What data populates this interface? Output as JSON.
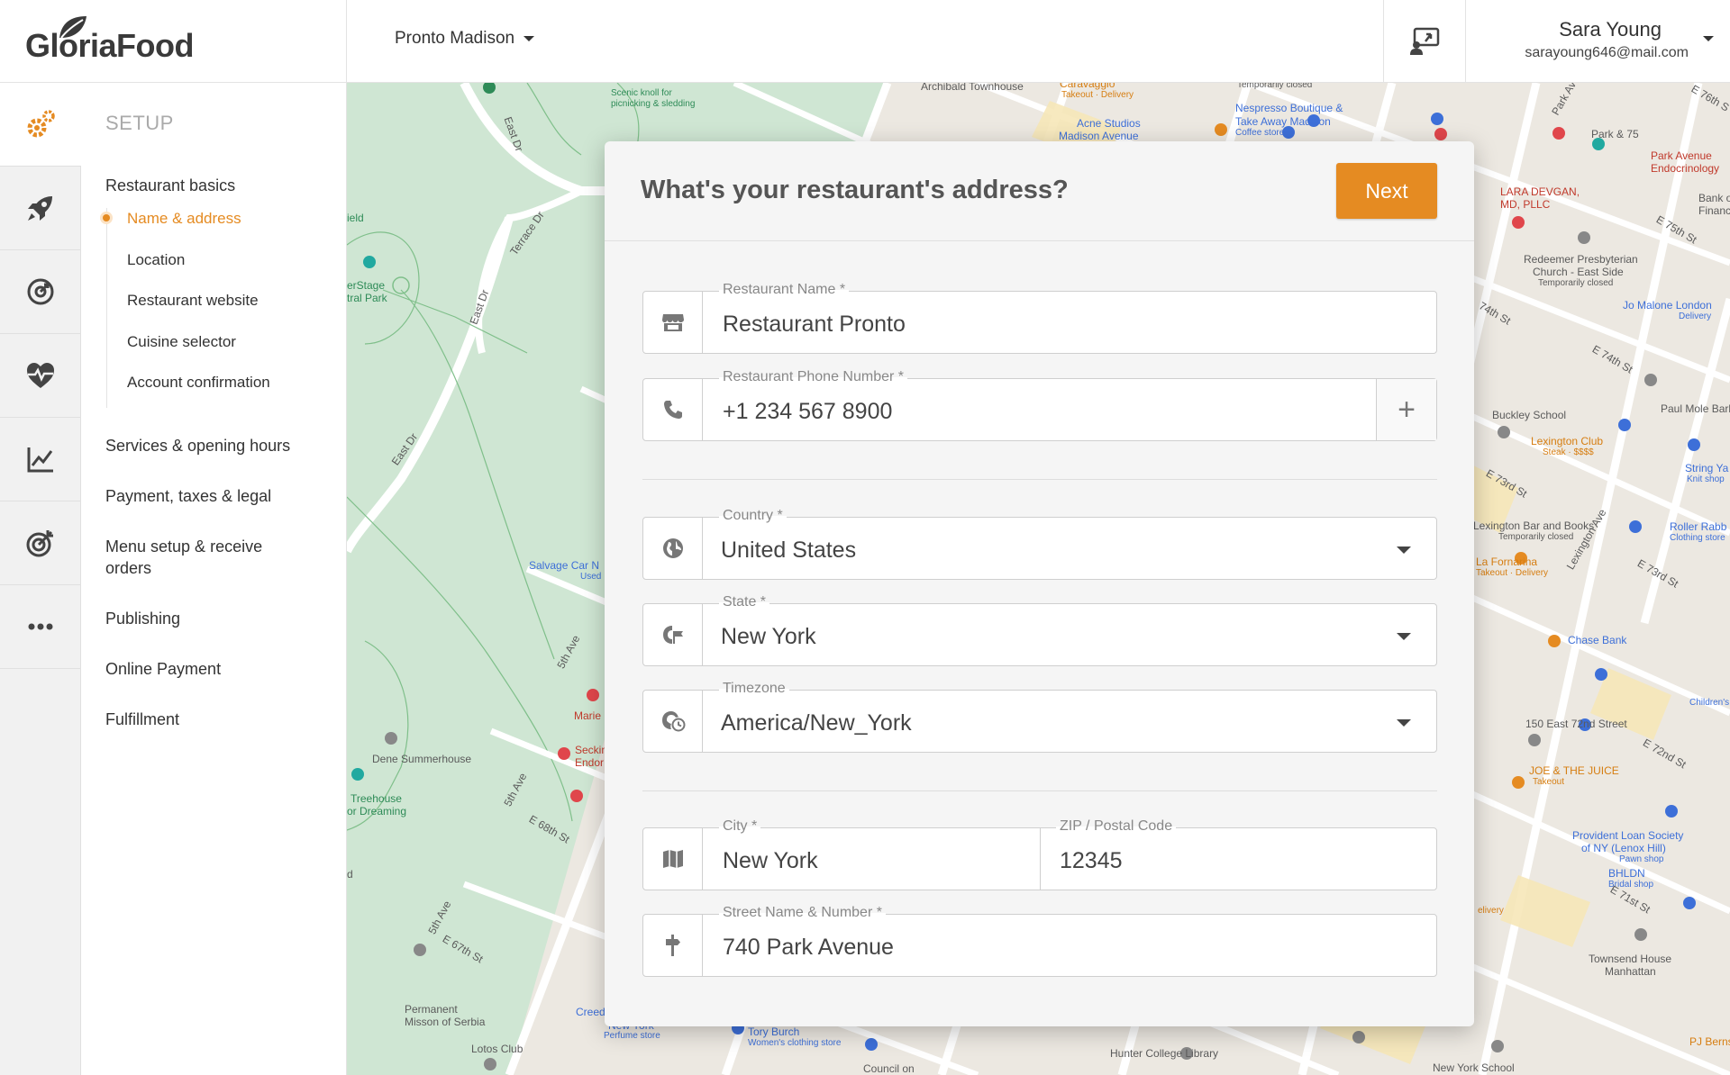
{
  "header": {
    "brand": "GloriaFood",
    "restaurant": "Pronto Madison",
    "user_name": "Sara Young",
    "user_email": "sarayoung646@mail.com"
  },
  "rail": {
    "items": [
      "gear-icon",
      "rocket-icon",
      "dashboard-icon",
      "heart-pulse-icon",
      "chart-icon",
      "target-icon",
      "more-icon"
    ]
  },
  "nav": {
    "title": "SETUP",
    "sections": {
      "basics": "Restaurant basics",
      "services": "Services & opening hours",
      "payment": "Payment, taxes & legal",
      "menu": "Menu setup & receive orders",
      "publishing": "Publishing",
      "online_payment": "Online Payment",
      "fulfillment": "Fulfillment"
    },
    "basics_items": [
      "Name & address",
      "Location",
      "Restaurant website",
      "Cuisine selector",
      "Account confirmation"
    ],
    "active_item": "Name & address"
  },
  "map_labels": {
    "archibald": "Archibald Townhouse",
    "caravaggio": "Caravaggio",
    "caravaggio_sub": "Takeout · Delivery",
    "temp_closed": "Temporarily closed",
    "nespresso1": "Nespresso Boutique &",
    "nespresso2": "Take Away Madison",
    "nespresso3": "Coffee store",
    "acne1": "Acne Studios",
    "acne2": "Madison Avenue",
    "pilgrim1": "Scenic knoll for",
    "pilgrim2": "picnicking & sledding",
    "park75": "Park & 75",
    "parkave1": "Park Avenue",
    "parkave2": "Endocrinology",
    "lara1": "LARA DEVGAN,",
    "lara2": "MD, PLLC",
    "bank1": "Bank of",
    "bank2": "Financi",
    "redeemer1": "Redeemer Presbyterian",
    "redeemer2": "Church - East Side",
    "redeemer3": "Temporarily closed",
    "jomalone1": "Jo Malone London",
    "jomalone2": "Delivery",
    "paulmole": "Paul Mole Barber S",
    "buckley": "Buckley School",
    "lexclub1": "Lexington Club",
    "lexclub2": "Steak · $$$$",
    "string1": "String Ya",
    "string2": "Knit shop",
    "lexbar1": "Lexington Bar and Books",
    "lexbar2": "Temporarily closed",
    "roller1": "Roller Rabb",
    "roller2": "Clothing store",
    "fornarina1": "La Fornarina",
    "fornarina2": "Takeout · Delivery",
    "chase": "Chase Bank",
    "east72": "150 East 72nd Street",
    "childrens": "Children's",
    "joe1": "JOE & THE JUICE",
    "joe2": "Takeout",
    "provident1": "Provident Loan Society",
    "provident2": "of NY (Lenox Hill)",
    "provident3": "Pawn shop",
    "bhldn1": "BHLDN",
    "bhldn2": "Bridal shop",
    "townsend1": "Townsend House",
    "townsend2": "Manhattan",
    "hunter": "Hunter College Library",
    "nyschool": "New York School",
    "pjb": "PJ Bernste",
    "council": "Council on",
    "tory1": "Tory Burch",
    "tory2": "Women's clothing store",
    "lotos": "Lotos Club",
    "permanent1": "Permanent",
    "permanent2": "Misson of Serbia",
    "dene": "Dene Summerhouse",
    "treehouse1": "Treehouse",
    "treehouse2": "or Dreaming",
    "salvage1": "Salvage Car N",
    "salvage2": "Used",
    "marie": "Marie",
    "seckin1": "Seckin",
    "seckin2": "Endor",
    "stage1": "erStage",
    "stage2": "tral Park",
    "field": "ield",
    "east_dr": "East Dr",
    "terrace_dr": "Terrace Dr",
    "st_e75": "E 75th St",
    "st_e74": "E 74th St",
    "st_74": "74th St",
    "st_e73": "E 73rd St",
    "st_e73b": "E 73rd St",
    "st_e72": "E 72nd St",
    "st_e71": "E 71st St",
    "st_e68": "E 68th St",
    "st_e67": "E 67th St",
    "lex_ave": "Lexington Ave",
    "park_ave": "Park Av",
    "ave_5th": "5th Ave",
    "ave_5thb": "5th Ave",
    "ave_5thc": "5th Ave",
    "st_e76": "E 76th S",
    "delivery": "elivery",
    "creed": "Creed",
    "newyork": "New York",
    "perfume": "Perfume store",
    "d": "d"
  },
  "dialog": {
    "title": "What's your restaurant's address?",
    "next_label": "Next",
    "fields": {
      "restaurant_name": {
        "label": "Restaurant Name *",
        "value": "Restaurant Pronto"
      },
      "phone": {
        "label": "Restaurant Phone Number *",
        "value": "+1 234 567 8900"
      },
      "country": {
        "label": "Country *",
        "value": "United States"
      },
      "state": {
        "label": "State *",
        "value": "New York"
      },
      "timezone": {
        "label": "Timezone",
        "value": "America/New_York"
      },
      "city": {
        "label": "City *",
        "value": "New York"
      },
      "zip": {
        "label": "ZIP / Postal Code",
        "value": "12345"
      },
      "street": {
        "label": "Street Name & Number *",
        "value": "740 Park Avenue"
      }
    }
  },
  "colors": {
    "accent": "#e58b22",
    "park_green": "#cfe6d3",
    "map_bg": "#ece8e1"
  }
}
